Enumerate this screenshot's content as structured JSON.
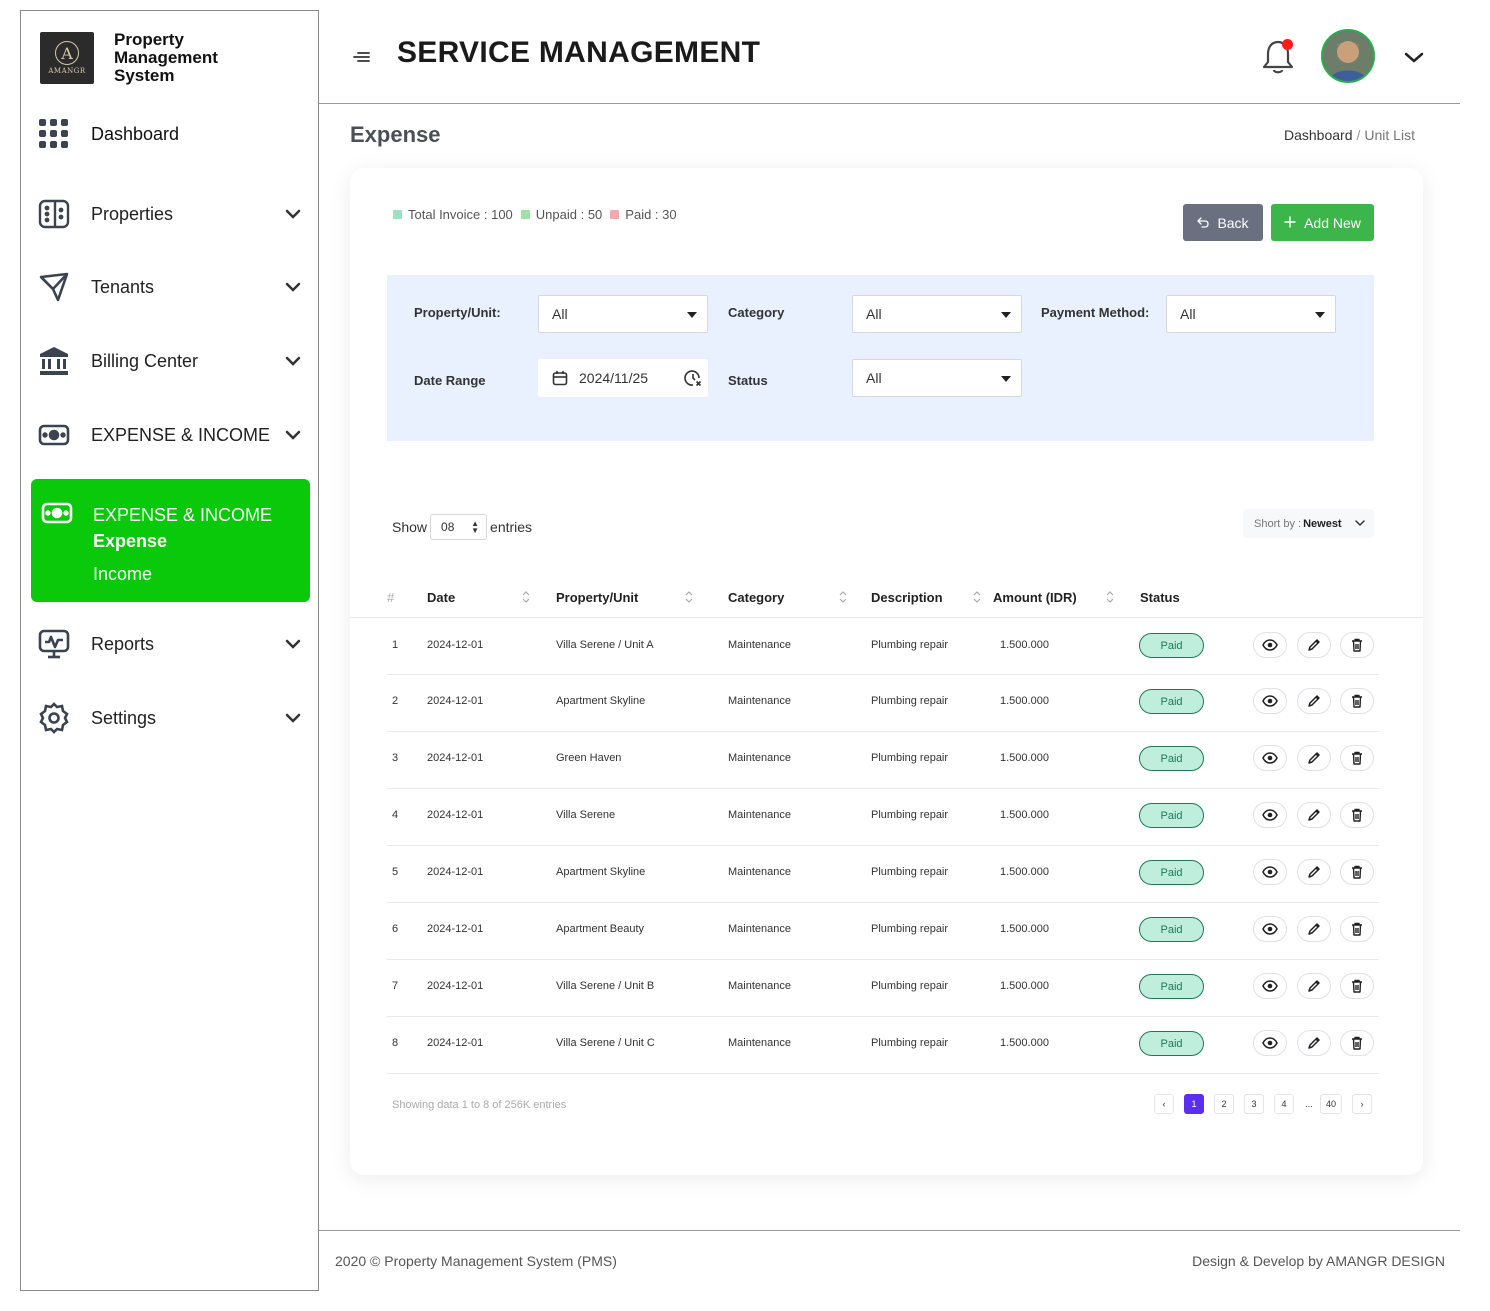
{
  "brand": {
    "logo_text": "AMANGR",
    "title": "Property Management System"
  },
  "sidebar": {
    "items": [
      {
        "label": "Dashboard",
        "icon": "grid-icon"
      },
      {
        "label": "Properties",
        "icon": "building-icon"
      },
      {
        "label": "Tenants",
        "icon": "send-icon"
      },
      {
        "label": "Billing Center",
        "icon": "bank-icon"
      },
      {
        "label": "EXPENSE & INCOME",
        "icon": "money-icon"
      }
    ],
    "active": {
      "label": "EXPENSE & INCOME",
      "icon": "money-icon",
      "sub_items": [
        {
          "label": "Expense",
          "selected": true
        },
        {
          "label": "Income",
          "selected": false
        }
      ]
    },
    "bottom_items": [
      {
        "label": "Reports",
        "icon": "monitor-icon"
      },
      {
        "label": "Settings",
        "icon": "gear-icon"
      }
    ]
  },
  "header": {
    "title": "SERVICE MANAGEMENT"
  },
  "page": {
    "section_title": "Expense",
    "breadcrumb": {
      "home": "Dashboard",
      "separator": "/",
      "current": "Unit List"
    }
  },
  "summary": [
    {
      "label": "Total Invoice : 100",
      "color": "#9de0c4"
    },
    {
      "label": "Unpaid : 50",
      "color": "#9ee0a6"
    },
    {
      "label": "Paid : 30",
      "color": "#f3a9b2"
    }
  ],
  "buttons": {
    "back": "Back",
    "add_new": "Add New"
  },
  "filters": {
    "property_label": "Property/Unit:",
    "property_value": "All",
    "category_label": "Category",
    "category_value": "All",
    "payment_label": "Payment Method:",
    "payment_value": "All",
    "date_label": "Date Range",
    "date_value": "2024/11/25",
    "status_label": "Status",
    "status_value": "All"
  },
  "table_controls": {
    "show_label": "Show",
    "entries_value": "08",
    "entries_label": "entries",
    "sort_label": "Short by :",
    "sort_value": "Newest"
  },
  "table": {
    "columns": [
      "#",
      "Date",
      "Property/Unit",
      "Category",
      "Description",
      "Amount (IDR)",
      "Status"
    ],
    "rows": [
      {
        "no": "1",
        "date": "2024-12-01",
        "property": "Villa Serene / Unit A",
        "category": "Maintenance",
        "description": "Plumbing repair",
        "amount": "1.500.000",
        "status": "Paid"
      },
      {
        "no": "2",
        "date": "2024-12-01",
        "property": "Apartment Skyline",
        "category": "Maintenance",
        "description": "Plumbing repair",
        "amount": "1.500.000",
        "status": "Paid"
      },
      {
        "no": "3",
        "date": "2024-12-01",
        "property": "Green Haven",
        "category": "Maintenance",
        "description": "Plumbing repair",
        "amount": "1.500.000",
        "status": "Paid"
      },
      {
        "no": "4",
        "date": "2024-12-01",
        "property": "Villa Serene",
        "category": "Maintenance",
        "description": "Plumbing repair",
        "amount": "1.500.000",
        "status": "Paid"
      },
      {
        "no": "5",
        "date": "2024-12-01",
        "property": "Apartment Skyline",
        "category": "Maintenance",
        "description": "Plumbing repair",
        "amount": "1.500.000",
        "status": "Paid"
      },
      {
        "no": "6",
        "date": "2024-12-01",
        "property": "Apartment Beauty",
        "category": "Maintenance",
        "description": "Plumbing repair",
        "amount": "1.500.000",
        "status": "Paid"
      },
      {
        "no": "7",
        "date": "2024-12-01",
        "property": "Villa Serene / Unit B",
        "category": "Maintenance",
        "description": "Plumbing repair",
        "amount": "1.500.000",
        "status": "Paid"
      },
      {
        "no": "8",
        "date": "2024-12-01",
        "property": "Villa Serene / Unit C",
        "category": "Maintenance",
        "description": "Plumbing repair",
        "amount": "1.500.000",
        "status": "Paid"
      }
    ]
  },
  "pagination": {
    "showing_text": "Showing data 1 to 8 of  256K entries",
    "prev": "‹",
    "pages": [
      "1",
      "2",
      "3",
      "4"
    ],
    "ellipsis": "...",
    "last": "40",
    "next": "›",
    "current": "1"
  },
  "footer": {
    "left": "2020 © Property Management System (PMS)",
    "right": "Design & Develop by AMANGR DESIGN"
  },
  "colors": {
    "accent_green": "#0ac80a",
    "add_button": "#3cb54a",
    "back_button": "#6b7080",
    "filter_bg": "#e8f1fd",
    "paid_badge_bg": "#bfeedd",
    "active_page": "#5a2ff0",
    "notification_dot": "#ff1a1a"
  }
}
